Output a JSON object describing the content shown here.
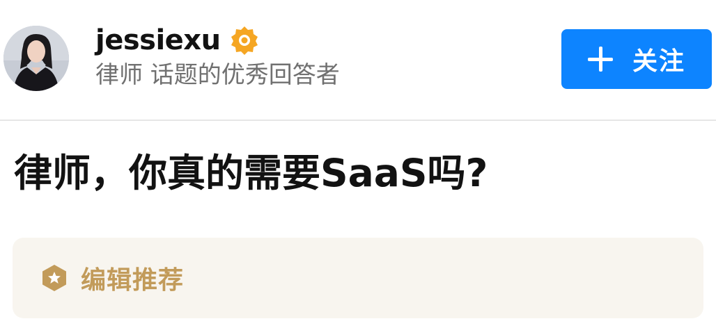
{
  "author": {
    "name": "jessiexu",
    "headline": "律师 话题的优秀回答者",
    "avatar_icon": "avatar-photo",
    "badge_icon": "verified-badge-icon",
    "badge_color": "#f5a623"
  },
  "follow_button": {
    "label": "关注",
    "icon": "plus-icon",
    "color": "#0d84ff"
  },
  "post": {
    "title": "律师，你真的需要SaaS吗?"
  },
  "editor_pick": {
    "label": "编辑推荐",
    "icon": "hexagon-badge-icon",
    "color": "#c29b5a",
    "background": "#f8f5ef"
  }
}
